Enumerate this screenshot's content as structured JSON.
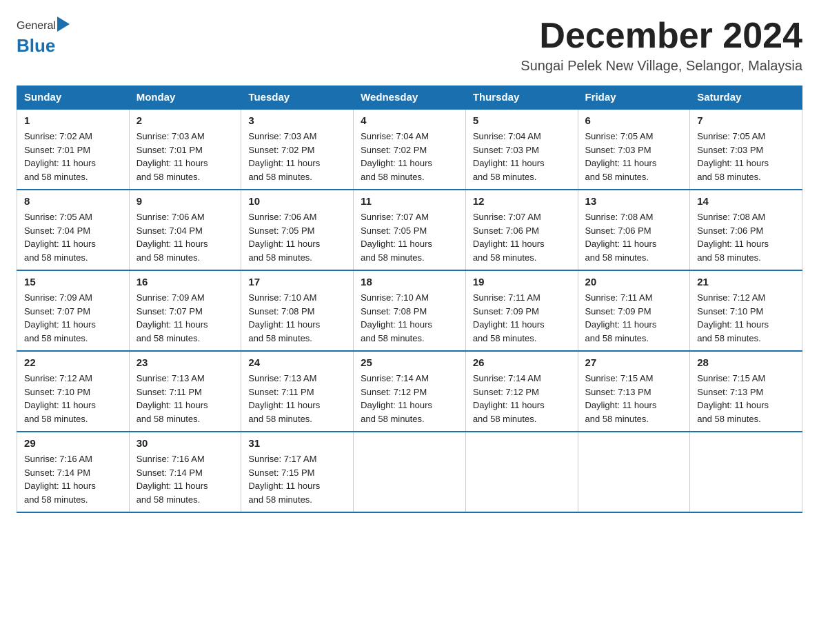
{
  "header": {
    "logo_general": "General",
    "logo_blue": "Blue",
    "month_title": "December 2024",
    "location": "Sungai Pelek New Village, Selangor, Malaysia"
  },
  "days_of_week": [
    "Sunday",
    "Monday",
    "Tuesday",
    "Wednesday",
    "Thursday",
    "Friday",
    "Saturday"
  ],
  "weeks": [
    [
      {
        "day": "1",
        "sunrise": "7:02 AM",
        "sunset": "7:01 PM",
        "daylight": "11 hours and 58 minutes."
      },
      {
        "day": "2",
        "sunrise": "7:03 AM",
        "sunset": "7:01 PM",
        "daylight": "11 hours and 58 minutes."
      },
      {
        "day": "3",
        "sunrise": "7:03 AM",
        "sunset": "7:02 PM",
        "daylight": "11 hours and 58 minutes."
      },
      {
        "day": "4",
        "sunrise": "7:04 AM",
        "sunset": "7:02 PM",
        "daylight": "11 hours and 58 minutes."
      },
      {
        "day": "5",
        "sunrise": "7:04 AM",
        "sunset": "7:03 PM",
        "daylight": "11 hours and 58 minutes."
      },
      {
        "day": "6",
        "sunrise": "7:05 AM",
        "sunset": "7:03 PM",
        "daylight": "11 hours and 58 minutes."
      },
      {
        "day": "7",
        "sunrise": "7:05 AM",
        "sunset": "7:03 PM",
        "daylight": "11 hours and 58 minutes."
      }
    ],
    [
      {
        "day": "8",
        "sunrise": "7:05 AM",
        "sunset": "7:04 PM",
        "daylight": "11 hours and 58 minutes."
      },
      {
        "day": "9",
        "sunrise": "7:06 AM",
        "sunset": "7:04 PM",
        "daylight": "11 hours and 58 minutes."
      },
      {
        "day": "10",
        "sunrise": "7:06 AM",
        "sunset": "7:05 PM",
        "daylight": "11 hours and 58 minutes."
      },
      {
        "day": "11",
        "sunrise": "7:07 AM",
        "sunset": "7:05 PM",
        "daylight": "11 hours and 58 minutes."
      },
      {
        "day": "12",
        "sunrise": "7:07 AM",
        "sunset": "7:06 PM",
        "daylight": "11 hours and 58 minutes."
      },
      {
        "day": "13",
        "sunrise": "7:08 AM",
        "sunset": "7:06 PM",
        "daylight": "11 hours and 58 minutes."
      },
      {
        "day": "14",
        "sunrise": "7:08 AM",
        "sunset": "7:06 PM",
        "daylight": "11 hours and 58 minutes."
      }
    ],
    [
      {
        "day": "15",
        "sunrise": "7:09 AM",
        "sunset": "7:07 PM",
        "daylight": "11 hours and 58 minutes."
      },
      {
        "day": "16",
        "sunrise": "7:09 AM",
        "sunset": "7:07 PM",
        "daylight": "11 hours and 58 minutes."
      },
      {
        "day": "17",
        "sunrise": "7:10 AM",
        "sunset": "7:08 PM",
        "daylight": "11 hours and 58 minutes."
      },
      {
        "day": "18",
        "sunrise": "7:10 AM",
        "sunset": "7:08 PM",
        "daylight": "11 hours and 58 minutes."
      },
      {
        "day": "19",
        "sunrise": "7:11 AM",
        "sunset": "7:09 PM",
        "daylight": "11 hours and 58 minutes."
      },
      {
        "day": "20",
        "sunrise": "7:11 AM",
        "sunset": "7:09 PM",
        "daylight": "11 hours and 58 minutes."
      },
      {
        "day": "21",
        "sunrise": "7:12 AM",
        "sunset": "7:10 PM",
        "daylight": "11 hours and 58 minutes."
      }
    ],
    [
      {
        "day": "22",
        "sunrise": "7:12 AM",
        "sunset": "7:10 PM",
        "daylight": "11 hours and 58 minutes."
      },
      {
        "day": "23",
        "sunrise": "7:13 AM",
        "sunset": "7:11 PM",
        "daylight": "11 hours and 58 minutes."
      },
      {
        "day": "24",
        "sunrise": "7:13 AM",
        "sunset": "7:11 PM",
        "daylight": "11 hours and 58 minutes."
      },
      {
        "day": "25",
        "sunrise": "7:14 AM",
        "sunset": "7:12 PM",
        "daylight": "11 hours and 58 minutes."
      },
      {
        "day": "26",
        "sunrise": "7:14 AM",
        "sunset": "7:12 PM",
        "daylight": "11 hours and 58 minutes."
      },
      {
        "day": "27",
        "sunrise": "7:15 AM",
        "sunset": "7:13 PM",
        "daylight": "11 hours and 58 minutes."
      },
      {
        "day": "28",
        "sunrise": "7:15 AM",
        "sunset": "7:13 PM",
        "daylight": "11 hours and 58 minutes."
      }
    ],
    [
      {
        "day": "29",
        "sunrise": "7:16 AM",
        "sunset": "7:14 PM",
        "daylight": "11 hours and 58 minutes."
      },
      {
        "day": "30",
        "sunrise": "7:16 AM",
        "sunset": "7:14 PM",
        "daylight": "11 hours and 58 minutes."
      },
      {
        "day": "31",
        "sunrise": "7:17 AM",
        "sunset": "7:15 PM",
        "daylight": "11 hours and 58 minutes."
      },
      null,
      null,
      null,
      null
    ]
  ],
  "labels": {
    "sunrise": "Sunrise:",
    "sunset": "Sunset:",
    "daylight": "Daylight:"
  }
}
